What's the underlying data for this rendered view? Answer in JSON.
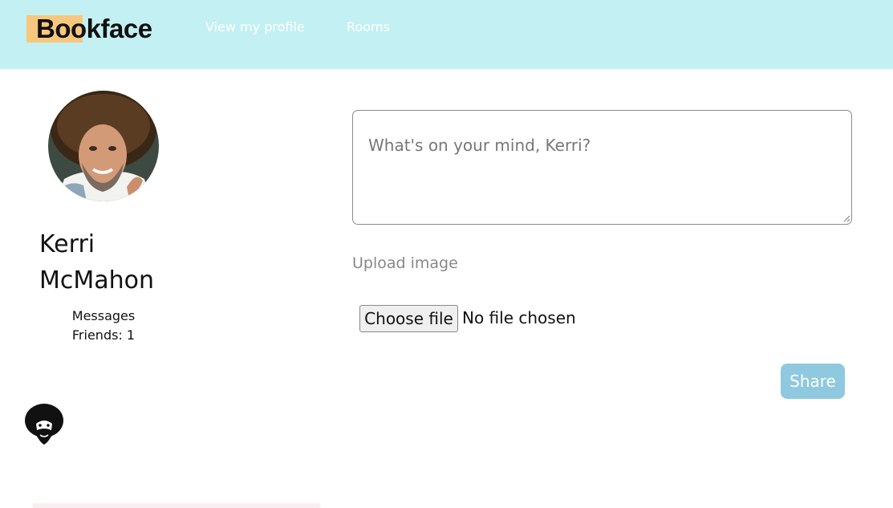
{
  "app": {
    "logo_text": "Bookface"
  },
  "nav": {
    "view_profile": "View my profile",
    "rooms": "Rooms"
  },
  "profile": {
    "first_name": "Kerri",
    "last_name": "McMahon",
    "messages_label": "Messages",
    "friends_label": "Friends: 1"
  },
  "composer": {
    "placeholder": "What's on your mind, Kerri?",
    "value": "",
    "upload_label": "Upload image",
    "choose_file_label": "Choose file",
    "no_file_text": "No file chosen",
    "share_label": "Share"
  },
  "icons": {
    "avatar": "profile-photo",
    "mini_avatar": "bob-ross-silhouette-icon"
  },
  "colors": {
    "header_bg": "#c3f0f3",
    "logo_highlight": "#f7c77d",
    "share_bg": "#8fc9df"
  }
}
